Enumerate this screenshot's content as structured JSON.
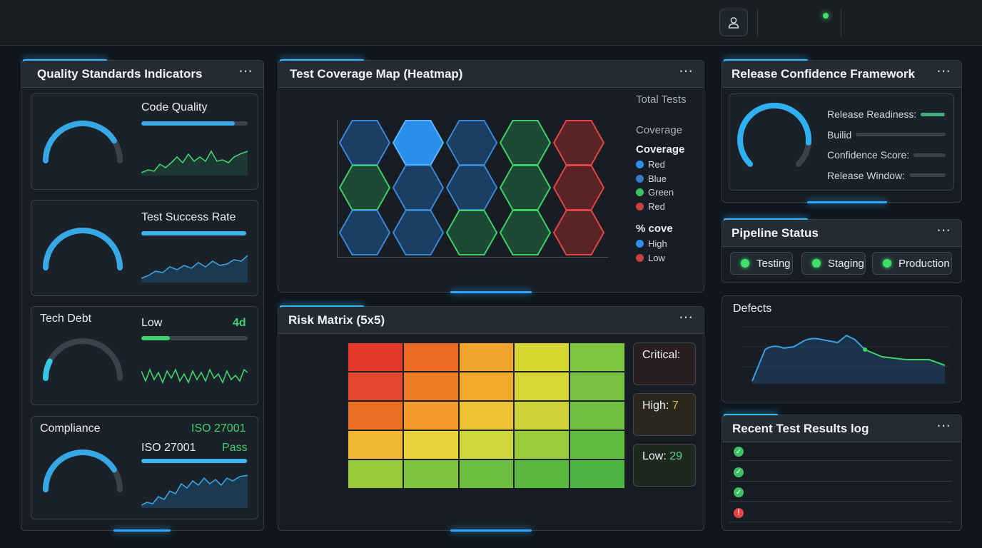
{
  "panels": {
    "quality": {
      "title": "Quality Standards Indicators"
    },
    "coverage": {
      "title": "Test Coverage Map (Heatmap)"
    },
    "release": {
      "title": "Release Confidence Framework"
    },
    "pipeline": {
      "title": "Pipeline Status"
    },
    "risk": {
      "title": "Risk Matrix (5x5)"
    },
    "defects": {
      "title": "Defects"
    },
    "log": {
      "title": "Recent Test Results log"
    }
  },
  "more_icon": "⋯",
  "quality": {
    "code_quality": {
      "label": "Code Quality",
      "bar": 0.88,
      "gauge": 0.82
    },
    "test_success": {
      "label": "Test Success Rate",
      "bar": 1.0,
      "gauge": 1.0
    },
    "tech_debt": {
      "label": "Tech Debt",
      "level": "Low",
      "value": "4d",
      "bar": 0.27,
      "gauge": 0.15
    },
    "compliance": {
      "label": "Compliance",
      "badge": "ISO 27001",
      "standard": "ISO 27001",
      "status": "Pass",
      "bar": 0.99,
      "gauge": 0.82
    }
  },
  "coverage": {
    "total_tests_label": "Total Tests",
    "coverage_label": "Coverage",
    "legend1_title": "Coverage",
    "legend1": [
      {
        "label": "Red",
        "color": "#2f8ff0"
      },
      {
        "label": "Blue",
        "color": "#3a7ac0"
      },
      {
        "label": "Green",
        "color": "#3ec164"
      },
      {
        "label": "Red",
        "color": "#c94040"
      }
    ],
    "legend2_title": "% cove",
    "legend2": [
      {
        "label": "High",
        "color": "#2f8ff0"
      },
      {
        "label": "Low",
        "color": "#c94040"
      }
    ],
    "grid": [
      [
        "blue",
        "blue-bright",
        "blue",
        "green",
        "red"
      ],
      [
        "green",
        "blue",
        "blue",
        "green",
        "red"
      ],
      [
        "blue",
        "blue",
        "green",
        "green",
        "red"
      ]
    ]
  },
  "release": {
    "rows": [
      {
        "label": "Release Readiness:",
        "fill": 0.95,
        "color": "#3fae7a"
      },
      {
        "label": "Builid",
        "fill": 0.0,
        "color": "#3fae7a"
      },
      {
        "label": "Confidence Score:",
        "fill": 0.0,
        "color": "#3fae7a"
      },
      {
        "label": "Release Window:",
        "fill": 0.0,
        "color": "#3fae7a"
      }
    ],
    "gauge": 0.85
  },
  "pipeline": {
    "stages": [
      {
        "label": "Testing",
        "status_color": "#3ee06a"
      },
      {
        "label": "Staging",
        "status_color": "#3ee06a"
      },
      {
        "label": "Production",
        "status_color": "#3ee06a"
      }
    ]
  },
  "risk": {
    "critical_label": "Critical:",
    "high_label": "High:",
    "high_value": "7",
    "low_label": "Low:",
    "low_value": "29",
    "colors": [
      [
        "#e33a2c",
        "#ee6a23",
        "#f0a52a",
        "#d7d530",
        "#7dc43f"
      ],
      [
        "#e5472c",
        "#ee7b26",
        "#f1aa2c",
        "#d8d633",
        "#77c241"
      ],
      [
        "#ec6f24",
        "#f39a2a",
        "#efc236",
        "#cdd238",
        "#6fc040"
      ],
      [
        "#f0b634",
        "#e8d43a",
        "#cdd63b",
        "#99cc3d",
        "#5fba40"
      ],
      [
        "#9ac93c",
        "#7ec33f",
        "#6cbe40",
        "#5bb942",
        "#4cb443"
      ]
    ]
  },
  "log": {
    "rows": [
      {
        "status": "pass",
        "color": "#3ec164",
        "glyph": "✓"
      },
      {
        "status": "pass",
        "color": "#3ec164",
        "glyph": "✓"
      },
      {
        "status": "pass",
        "color": "#3ec164",
        "glyph": "✓"
      },
      {
        "status": "fail",
        "color": "#e34545",
        "glyph": "!"
      }
    ]
  }
}
